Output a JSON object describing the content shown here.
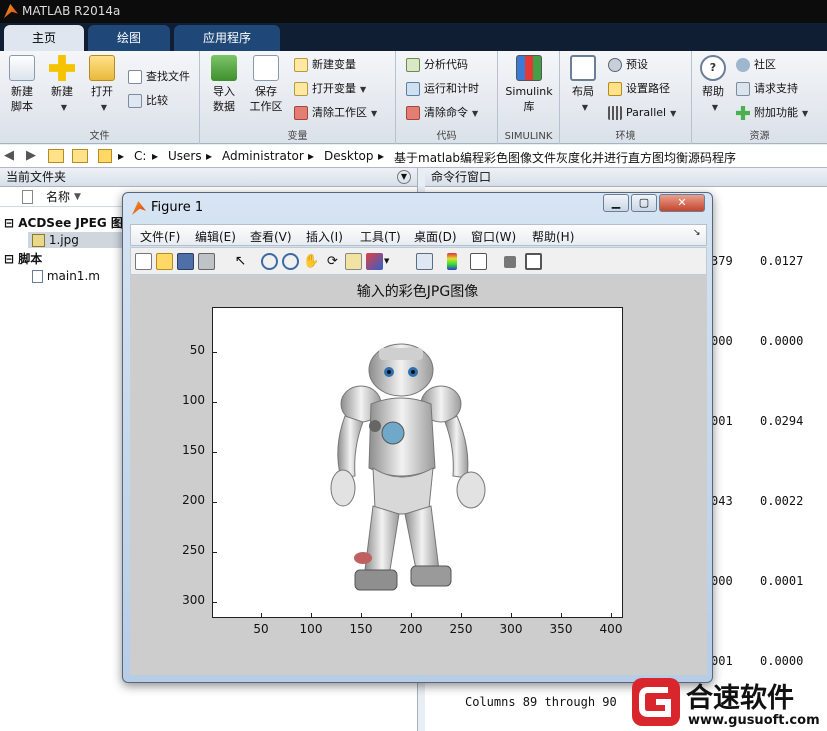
{
  "window": {
    "title": "MATLAB R2014a"
  },
  "tabs": [
    "主页",
    "绘图",
    "应用程序"
  ],
  "ribbon": {
    "file": {
      "new_script": "新建\n脚本",
      "new": "新建",
      "open": "打开",
      "find_files": "查找文件",
      "compare": "比较",
      "label": "文件"
    },
    "variable": {
      "import": "导入\n数据",
      "save_ws": "保存\n工作区",
      "new_var": "新建变量",
      "open_var": "打开变量",
      "clear_ws": "清除工作区",
      "label": "变量"
    },
    "code": {
      "analyze": "分析代码",
      "run_time": "运行和计时",
      "clear_cmd": "清除命令",
      "label": "代码"
    },
    "simulink": {
      "lib": "Simulink\n库",
      "label": "SIMULINK"
    },
    "env": {
      "layout": "布局",
      "prefs": "预设",
      "set_path": "设置路径",
      "parallel": "Parallel",
      "label": "环境"
    },
    "resources": {
      "help": "帮助",
      "community": "社区",
      "support": "请求支持",
      "addons": "附加功能",
      "label": "资源"
    }
  },
  "address": {
    "crumbs": [
      "C:",
      "Users",
      "Administrator",
      "Desktop",
      "基于matlab编程彩色图像文件灰度化并进行直方图均衡源码程序"
    ]
  },
  "current_folder": {
    "title": "当前文件夹",
    "col_name": "名称",
    "groups": [
      {
        "name": "ACDSee JPEG 图像",
        "items": [
          "1.jpg"
        ]
      },
      {
        "name": "脚本",
        "items": [
          "main1.m"
        ]
      }
    ]
  },
  "command_window": {
    "title": "命令行窗口",
    "rows": [
      [
        "379",
        "0.0127"
      ],
      [
        "000",
        "0.0000"
      ],
      [
        "001",
        "0.0294"
      ],
      [
        "043",
        "0.0022"
      ],
      [
        "000",
        "0.0001"
      ],
      [
        "001",
        "0.0000"
      ]
    ],
    "columns_line": "Columns 89 through 90"
  },
  "figure": {
    "title": "Figure 1",
    "menu": [
      "文件(F)",
      "编辑(E)",
      "查看(V)",
      "插入(I)",
      "工具(T)",
      "桌面(D)",
      "窗口(W)",
      "帮助(H)"
    ],
    "plot_title": "输入的彩色JPG图像",
    "yticks": [
      "50",
      "100",
      "150",
      "200",
      "250",
      "300"
    ],
    "xticks": [
      "50",
      "100",
      "150",
      "200",
      "250",
      "300",
      "350",
      "400"
    ]
  },
  "watermark": {
    "name": "合速软件",
    "url": "www.gusuoft.com"
  },
  "colors": {
    "tab_bg": "#1f4778",
    "title_bg": "#0c0c0c",
    "figure_frame": "#b7cde6"
  }
}
